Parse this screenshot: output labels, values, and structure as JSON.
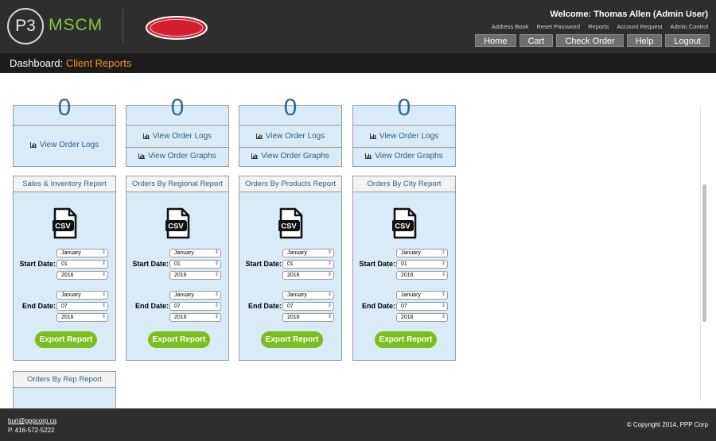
{
  "header": {
    "logo_p3": "P3",
    "logo_mscm": "MSCM",
    "brand": "Barilla",
    "welcome": "Welcome: Thomas Allen (Admin User)",
    "top_links": [
      "Address Book",
      "Reset Password",
      "Reports",
      "Account Request",
      "Admin Control"
    ],
    "nav_buttons": [
      "Home",
      "Cart",
      "Check Order",
      "Help",
      "Logout"
    ]
  },
  "titlebar": {
    "prefix": "Dashboard: ",
    "page": "Client Reports"
  },
  "top_cards": [
    {
      "value": "0",
      "links": [
        "View Order Logs"
      ]
    },
    {
      "value": "0",
      "links": [
        "View Order Logs",
        "View Order Graphs"
      ]
    },
    {
      "value": "0",
      "links": [
        "View Order Logs",
        "View Order Graphs"
      ]
    },
    {
      "value": "0",
      "links": [
        "View Order Logs",
        "View Order Graphs"
      ]
    }
  ],
  "report_cards": [
    {
      "title": "Sales & Inventory Report"
    },
    {
      "title": "Orders By Regional Report"
    },
    {
      "title": "Orders By Products Report"
    },
    {
      "title": "Orders By City Report"
    }
  ],
  "report_form": {
    "start_label": "Start Date:",
    "end_label": "End Date:",
    "start_month": "January",
    "start_day": "01",
    "start_year": "2016",
    "end_month": "January",
    "end_day": "07",
    "end_year": "2016",
    "export_label": "Export Report",
    "file_icon_text": "CSV"
  },
  "partial_cards": [
    {
      "title": "Orders By Rep Report"
    }
  ],
  "footer": {
    "email": "buri@pppcorp.ca",
    "phone": "P. 416-572-5222",
    "copyright": "© Copyright 2014, PPP Corp"
  },
  "colors": {
    "header_bg": "#2e2e2e",
    "titlebar_bg": "#1c1c1c",
    "accent_orange": "#f7931e",
    "accent_green": "#8cc63f",
    "card_bg": "#d8ebf6",
    "export_green": "#7bbf1e",
    "brand_red": "#d3202f"
  }
}
